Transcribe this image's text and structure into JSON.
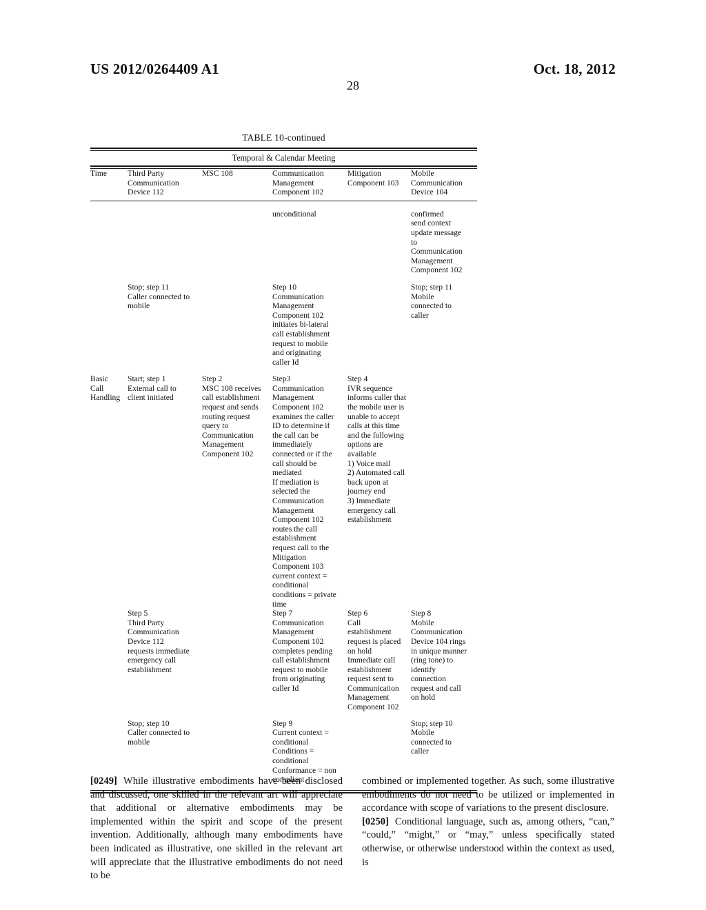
{
  "header": {
    "publication_number": "US 2012/0264409 A1",
    "publication_date": "Oct. 18, 2012",
    "page_number": "28"
  },
  "table": {
    "caption": "TABLE 10-continued",
    "subtitle": "Temporal & Calendar Meeting",
    "columns": [
      "Time",
      "Third Party\nCommunication\nDevice 112",
      "MSC 108",
      "Communication\nManagement\nComponent 102",
      "Mitigation\nComponent 103",
      "Mobile\nCommunication\nDevice 104"
    ],
    "rows": [
      {
        "time": "",
        "third_party": "",
        "msc": "",
        "cmc": "unconditional",
        "mitigation": "",
        "mobile": "confirmed\nsend context\nupdate message\nto\nCommunication\nManagement\nComponent 102"
      },
      {
        "time": "",
        "third_party": "Stop; step 11\nCaller connected to\nmobile",
        "msc": "",
        "cmc": "Step 10\nCommunication\nManagement\nComponent 102\ninitiates bi-lateral\ncall establishment\nrequest to mobile\nand originating\ncaller Id",
        "mitigation": "",
        "mobile": "Stop; step 11\nMobile\nconnected to\ncaller"
      },
      {
        "time": "Basic\nCall\nHandling",
        "third_party": "Start; step 1\nExternal call to\nclient initiated",
        "msc": "Step 2\nMSC 108 receives\ncall establishment\nrequest and sends\nrouting request\nquery to\nCommunication\nManagement\nComponent 102",
        "cmc": "Step3\nCommunication\nManagement\nComponent 102\nexamines the caller\nID to determine if\nthe call can be\nimmediately\nconnected or if the\ncall should be\nmediated\nIf mediation is\nselected the\nCommunication\nManagement\nComponent 102\nroutes the call\nestablishment\nrequest call to the\nMitigation\nComponent 103\ncurrent context =\nconditional\nconditions = private\ntime",
        "mitigation": "Step 4\nIVR sequence\ninforms caller that\nthe mobile user is\nunable to accept\ncalls at this time\nand the following\noptions are\navailable\n1) Voice mail\n2) Automated call\nback upon at\njourney end\n3) Immediate\nemergency call\nestablishment",
        "mobile": ""
      },
      {
        "time": "",
        "third_party": "Step 5\nThird Party\nCommunication\nDevice 112\nrequests immediate\nemergency call\nestablishment",
        "msc": "",
        "cmc": "Step 7\nCommunication\nManagement\nComponent 102\ncompletes pending\ncall establishment\nrequest to mobile\nfrom originating\ncaller Id",
        "mitigation": "Step 6\nCall\nestablishment\nrequest is placed\non hold\nImmediate call\nestablishment\nrequest sent to\nCommunication\nManagement\nComponent 102",
        "mobile": "Step 8\nMobile\nCommunication\nDevice 104 rings\nin unique manner\n(ring tone) to\nidentify\nconnection\nrequest and call\non hold"
      },
      {
        "time": "",
        "third_party": "Stop; step 10\nCaller connected to\nmobile",
        "msc": "",
        "cmc": "Step 9\nCurrent context =\nconditional\nConditions =\nconditional\nConformance = non\ncompliant",
        "mitigation": "",
        "mobile": "Stop; step 10\nMobile\nconnected to\ncaller"
      }
    ]
  },
  "body": {
    "left_column": [
      {
        "number": "[0249]",
        "text": "While illustrative embodiments have been disclosed and discussed, one skilled in the relevant art will appreciate that additional or alternative embodiments may be implemented within the spirit and scope of the present invention. Additionally, although many embodiments have been indicated as illustrative, one skilled in the relevant art will appreciate that the illustrative embodiments do not need to be"
      }
    ],
    "right_column": [
      {
        "number": "",
        "text": "combined or implemented together. As such, some illustrative embodiments do not need to be utilized or implemented in accordance with scope of variations to the present disclosure."
      },
      {
        "number": "[0250]",
        "text": "Conditional language, such as, among others, “can,” “could,” “might,” or “may,” unless specifically stated otherwise, or otherwise understood within the context as used, is"
      }
    ]
  }
}
